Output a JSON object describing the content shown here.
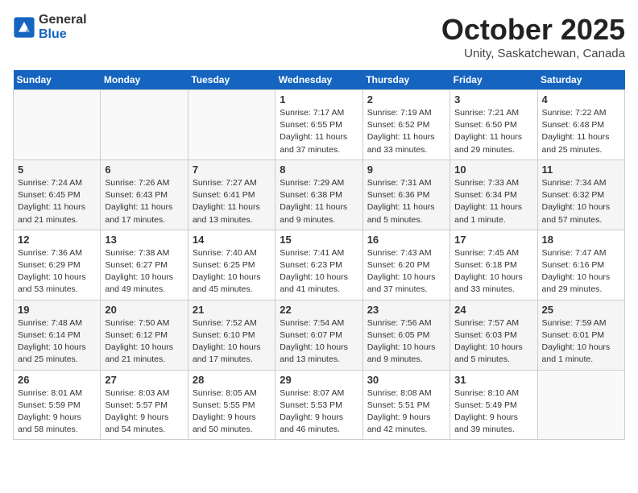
{
  "header": {
    "logo_general": "General",
    "logo_blue": "Blue",
    "month_title": "October 2025",
    "subtitle": "Unity, Saskatchewan, Canada"
  },
  "days_of_week": [
    "Sunday",
    "Monday",
    "Tuesday",
    "Wednesday",
    "Thursday",
    "Friday",
    "Saturday"
  ],
  "weeks": [
    [
      {
        "num": "",
        "empty": true
      },
      {
        "num": "",
        "empty": true
      },
      {
        "num": "",
        "empty": true
      },
      {
        "num": "1",
        "sunrise": "7:17 AM",
        "sunset": "6:55 PM",
        "daylight": "11 hours and 37 minutes."
      },
      {
        "num": "2",
        "sunrise": "7:19 AM",
        "sunset": "6:52 PM",
        "daylight": "11 hours and 33 minutes."
      },
      {
        "num": "3",
        "sunrise": "7:21 AM",
        "sunset": "6:50 PM",
        "daylight": "11 hours and 29 minutes."
      },
      {
        "num": "4",
        "sunrise": "7:22 AM",
        "sunset": "6:48 PM",
        "daylight": "11 hours and 25 minutes."
      }
    ],
    [
      {
        "num": "5",
        "sunrise": "7:24 AM",
        "sunset": "6:45 PM",
        "daylight": "11 hours and 21 minutes."
      },
      {
        "num": "6",
        "sunrise": "7:26 AM",
        "sunset": "6:43 PM",
        "daylight": "11 hours and 17 minutes."
      },
      {
        "num": "7",
        "sunrise": "7:27 AM",
        "sunset": "6:41 PM",
        "daylight": "11 hours and 13 minutes."
      },
      {
        "num": "8",
        "sunrise": "7:29 AM",
        "sunset": "6:38 PM",
        "daylight": "11 hours and 9 minutes."
      },
      {
        "num": "9",
        "sunrise": "7:31 AM",
        "sunset": "6:36 PM",
        "daylight": "11 hours and 5 minutes."
      },
      {
        "num": "10",
        "sunrise": "7:33 AM",
        "sunset": "6:34 PM",
        "daylight": "11 hours and 1 minute."
      },
      {
        "num": "11",
        "sunrise": "7:34 AM",
        "sunset": "6:32 PM",
        "daylight": "10 hours and 57 minutes."
      }
    ],
    [
      {
        "num": "12",
        "sunrise": "7:36 AM",
        "sunset": "6:29 PM",
        "daylight": "10 hours and 53 minutes."
      },
      {
        "num": "13",
        "sunrise": "7:38 AM",
        "sunset": "6:27 PM",
        "daylight": "10 hours and 49 minutes."
      },
      {
        "num": "14",
        "sunrise": "7:40 AM",
        "sunset": "6:25 PM",
        "daylight": "10 hours and 45 minutes."
      },
      {
        "num": "15",
        "sunrise": "7:41 AM",
        "sunset": "6:23 PM",
        "daylight": "10 hours and 41 minutes."
      },
      {
        "num": "16",
        "sunrise": "7:43 AM",
        "sunset": "6:20 PM",
        "daylight": "10 hours and 37 minutes."
      },
      {
        "num": "17",
        "sunrise": "7:45 AM",
        "sunset": "6:18 PM",
        "daylight": "10 hours and 33 minutes."
      },
      {
        "num": "18",
        "sunrise": "7:47 AM",
        "sunset": "6:16 PM",
        "daylight": "10 hours and 29 minutes."
      }
    ],
    [
      {
        "num": "19",
        "sunrise": "7:48 AM",
        "sunset": "6:14 PM",
        "daylight": "10 hours and 25 minutes."
      },
      {
        "num": "20",
        "sunrise": "7:50 AM",
        "sunset": "6:12 PM",
        "daylight": "10 hours and 21 minutes."
      },
      {
        "num": "21",
        "sunrise": "7:52 AM",
        "sunset": "6:10 PM",
        "daylight": "10 hours and 17 minutes."
      },
      {
        "num": "22",
        "sunrise": "7:54 AM",
        "sunset": "6:07 PM",
        "daylight": "10 hours and 13 minutes."
      },
      {
        "num": "23",
        "sunrise": "7:56 AM",
        "sunset": "6:05 PM",
        "daylight": "10 hours and 9 minutes."
      },
      {
        "num": "24",
        "sunrise": "7:57 AM",
        "sunset": "6:03 PM",
        "daylight": "10 hours and 5 minutes."
      },
      {
        "num": "25",
        "sunrise": "7:59 AM",
        "sunset": "6:01 PM",
        "daylight": "10 hours and 1 minute."
      }
    ],
    [
      {
        "num": "26",
        "sunrise": "8:01 AM",
        "sunset": "5:59 PM",
        "daylight": "9 hours and 58 minutes."
      },
      {
        "num": "27",
        "sunrise": "8:03 AM",
        "sunset": "5:57 PM",
        "daylight": "9 hours and 54 minutes."
      },
      {
        "num": "28",
        "sunrise": "8:05 AM",
        "sunset": "5:55 PM",
        "daylight": "9 hours and 50 minutes."
      },
      {
        "num": "29",
        "sunrise": "8:07 AM",
        "sunset": "5:53 PM",
        "daylight": "9 hours and 46 minutes."
      },
      {
        "num": "30",
        "sunrise": "8:08 AM",
        "sunset": "5:51 PM",
        "daylight": "9 hours and 42 minutes."
      },
      {
        "num": "31",
        "sunrise": "8:10 AM",
        "sunset": "5:49 PM",
        "daylight": "9 hours and 39 minutes."
      },
      {
        "num": "",
        "empty": true
      }
    ]
  ]
}
